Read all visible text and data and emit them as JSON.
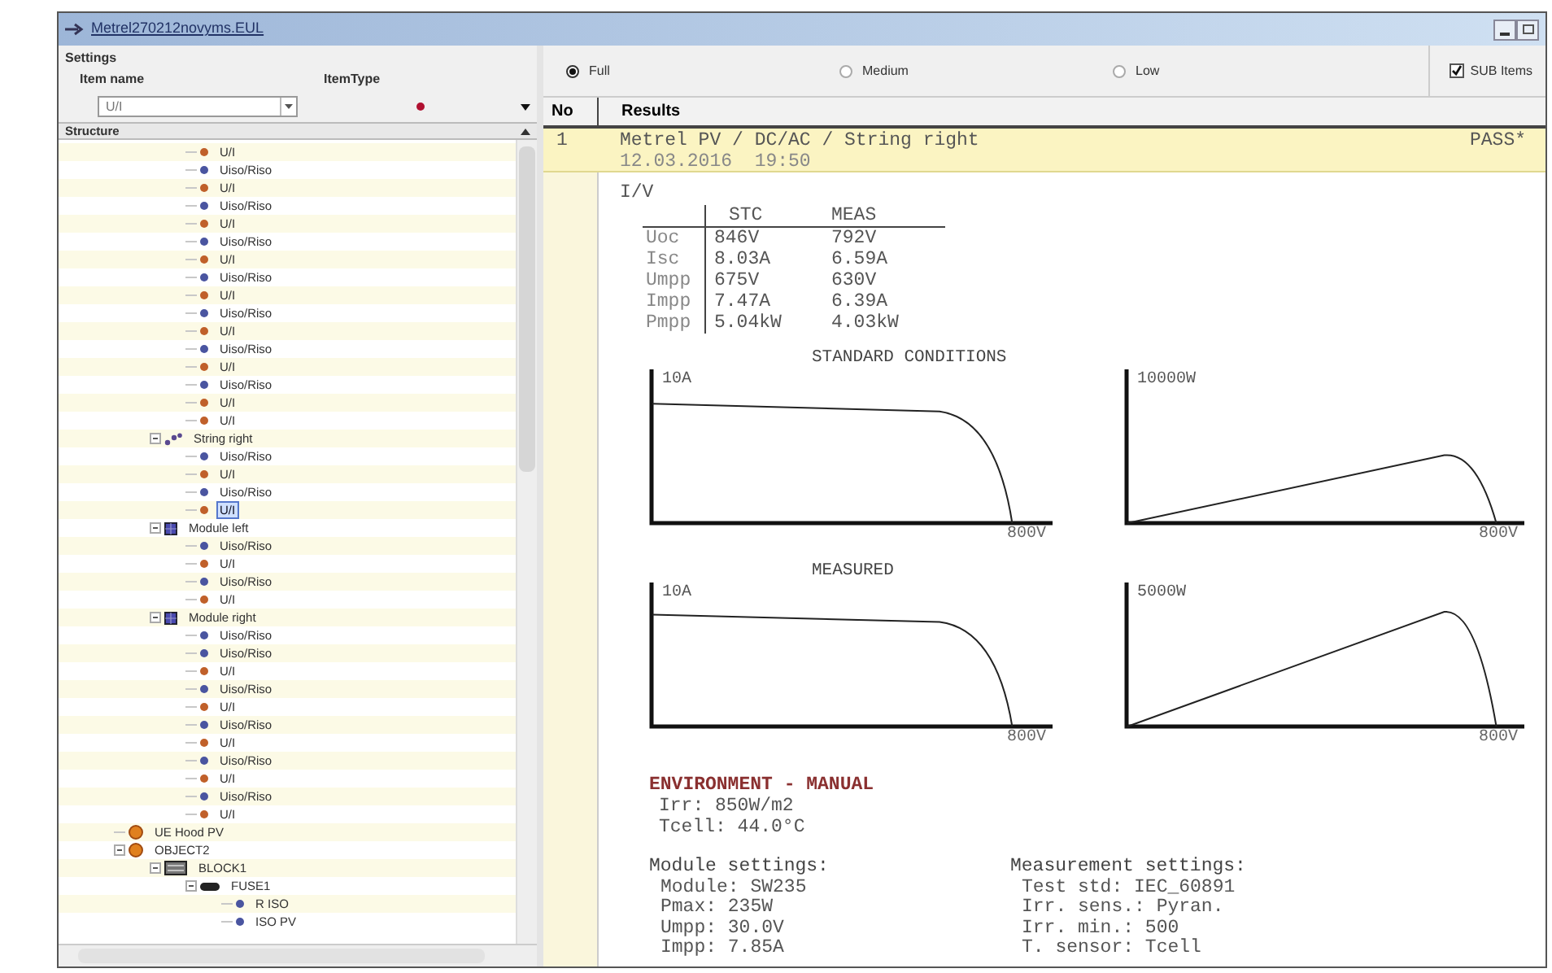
{
  "window": {
    "title": "Metrel270212novyms.EUL"
  },
  "settings": {
    "group_label": "Settings",
    "item_name_label": "Item name",
    "item_type_label": "ItemType",
    "item_name_value": "U/I"
  },
  "structure": {
    "header": "Structure",
    "tree": [
      {
        "children": [
          {
            "children": [
              {
                "label": "U/I",
                "kind": "leaf",
                "color": "#c0602a",
                "selected": false
              },
              {
                "label": "Uiso/Riso",
                "kind": "leaf",
                "color": "#4a55a0",
                "selected": false
              },
              {
                "label": "U/I",
                "kind": "leaf",
                "color": "#c0602a",
                "selected": false
              },
              {
                "label": "Uiso/Riso",
                "kind": "leaf",
                "color": "#4a55a0",
                "selected": false
              },
              {
                "label": "U/I",
                "kind": "leaf",
                "color": "#c0602a",
                "selected": false
              },
              {
                "label": "Uiso/Riso",
                "kind": "leaf",
                "color": "#4a55a0",
                "selected": false
              },
              {
                "label": "U/I",
                "kind": "leaf",
                "color": "#c0602a",
                "selected": false
              },
              {
                "label": "Uiso/Riso",
                "kind": "leaf",
                "color": "#4a55a0",
                "selected": false
              },
              {
                "label": "U/I",
                "kind": "leaf",
                "color": "#c0602a",
                "selected": false
              },
              {
                "label": "Uiso/Riso",
                "kind": "leaf",
                "color": "#4a55a0",
                "selected": false
              },
              {
                "label": "U/I",
                "kind": "leaf",
                "color": "#c0602a",
                "selected": false
              },
              {
                "label": "Uiso/Riso",
                "kind": "leaf",
                "color": "#4a55a0",
                "selected": false
              },
              {
                "label": "U/I",
                "kind": "leaf",
                "color": "#c0602a",
                "selected": false
              },
              {
                "label": "Uiso/Riso",
                "kind": "leaf",
                "color": "#4a55a0",
                "selected": false
              },
              {
                "label": "U/I",
                "kind": "leaf",
                "color": "#c0602a",
                "selected": false
              },
              {
                "label": "U/I",
                "kind": "leaf",
                "color": "#c0602a",
                "selected": false
              }
            ]
          },
          {
            "label": "String right",
            "kind": "string",
            "selected": false,
            "expanded": true,
            "children": [
              {
                "label": "Uiso/Riso",
                "kind": "leaf",
                "color": "#4a55a0",
                "selected": false
              },
              {
                "label": "U/I",
                "kind": "leaf",
                "color": "#c0602a",
                "selected": false
              },
              {
                "label": "Uiso/Riso",
                "kind": "leaf",
                "color": "#4a55a0",
                "selected": false
              },
              {
                "label": "U/I",
                "kind": "leaf",
                "color": "#c0602a",
                "selected": true
              }
            ]
          },
          {
            "label": "Module left",
            "kind": "module",
            "selected": false,
            "expanded": true,
            "children": [
              {
                "label": "Uiso/Riso",
                "kind": "leaf",
                "color": "#4a55a0",
                "selected": false
              },
              {
                "label": "U/I",
                "kind": "leaf",
                "color": "#c0602a",
                "selected": false
              },
              {
                "label": "Uiso/Riso",
                "kind": "leaf",
                "color": "#4a55a0",
                "selected": false
              },
              {
                "label": "U/I",
                "kind": "leaf",
                "color": "#c0602a",
                "selected": false
              }
            ]
          },
          {
            "label": "Module right",
            "kind": "module",
            "selected": false,
            "expanded": true,
            "children": [
              {
                "label": "Uiso/Riso",
                "kind": "leaf",
                "color": "#4a55a0",
                "selected": false
              },
              {
                "label": "Uiso/Riso",
                "kind": "leaf",
                "color": "#4a55a0",
                "selected": false
              },
              {
                "label": "U/I",
                "kind": "leaf",
                "color": "#c0602a",
                "selected": false
              },
              {
                "label": "Uiso/Riso",
                "kind": "leaf",
                "color": "#4a55a0",
                "selected": false
              },
              {
                "label": "U/I",
                "kind": "leaf",
                "color": "#c0602a",
                "selected": false
              },
              {
                "label": "Uiso/Riso",
                "kind": "leaf",
                "color": "#4a55a0",
                "selected": false
              },
              {
                "label": "U/I",
                "kind": "leaf",
                "color": "#c0602a",
                "selected": false
              },
              {
                "label": "Uiso/Riso",
                "kind": "leaf",
                "color": "#4a55a0",
                "selected": false
              },
              {
                "label": "U/I",
                "kind": "leaf",
                "color": "#c0602a",
                "selected": false
              },
              {
                "label": "Uiso/Riso",
                "kind": "leaf",
                "color": "#4a55a0",
                "selected": false
              },
              {
                "label": "U/I",
                "kind": "leaf",
                "color": "#c0602a",
                "selected": false
              }
            ]
          }
        ]
      },
      {
        "label": "UE Hood PV",
        "kind": "object",
        "selected": false
      },
      {
        "label": "OBJECT2",
        "kind": "object",
        "selected": false,
        "expanded": true,
        "children": [
          {
            "label": "BLOCK1",
            "kind": "block",
            "selected": false,
            "expanded": true,
            "children": [
              {
                "label": "FUSE1",
                "kind": "fuse",
                "selected": false,
                "expanded": true,
                "children": [
                  {
                    "label": "R ISO",
                    "kind": "leaf",
                    "color": "#4a55a0",
                    "selected": false
                  },
                  {
                    "label": "ISO PV",
                    "kind": "leaf",
                    "color": "#4a55a0",
                    "selected": false
                  }
                ]
              }
            ]
          }
        ]
      }
    ]
  },
  "detail_options": [
    {
      "label": "Full",
      "selected": true
    },
    {
      "label": "Medium",
      "selected": false
    },
    {
      "label": "Low",
      "selected": false
    }
  ],
  "sub_items": {
    "label": "SUB Items",
    "checked": true
  },
  "results": {
    "columns": [
      "No",
      "Results"
    ],
    "rows": [
      {
        "no": "1",
        "title": "Metrel PV / DC/AC / String right",
        "date": "12.03.2016  19:50",
        "status": "PASS*"
      }
    ]
  },
  "report": {
    "section": "I/V",
    "iv_table": {
      "columns": [
        "",
        "STC",
        "MEAS"
      ],
      "rows": [
        [
          "Uoc",
          "846V",
          "792V"
        ],
        [
          "Isc",
          "8.03A",
          "6.59A"
        ],
        [
          "Umpp",
          "675V",
          "630V"
        ],
        [
          "Impp",
          "7.47A",
          "6.39A"
        ],
        [
          "Pmpp",
          "5.04kW",
          "4.03kW"
        ]
      ]
    },
    "chart_groups": [
      {
        "title": "STANDARD CONDITIONS",
        "plots": [
          {
            "kind": "current",
            "y_label": "10A",
            "x_label": "800V"
          },
          {
            "kind": "power",
            "y_label": "10000W",
            "x_label": "800V"
          }
        ]
      },
      {
        "title": "MEASURED",
        "plots": [
          {
            "kind": "current",
            "y_label": "10A",
            "x_label": "800V"
          },
          {
            "kind": "power",
            "y_label": "5000W",
            "x_label": "800V"
          }
        ]
      }
    ],
    "environment": {
      "title": "ENVIRONMENT - MANUAL",
      "lines": [
        "Irr: 850W/m2",
        "Tcell: 44.0°C"
      ]
    },
    "module_settings": {
      "title": "Module settings:",
      "lines": [
        "Module: SW235",
        "Pmax: 235W",
        "Umpp: 30.0V",
        "Impp: 7.85A"
      ]
    },
    "measurement_settings": {
      "title": "Measurement settings:",
      "lines": [
        "Test std: IEC_60891",
        "Irr. sens.: Pyran.",
        "Irr. min.: 500",
        "T. sensor: Tcell"
      ]
    }
  }
}
